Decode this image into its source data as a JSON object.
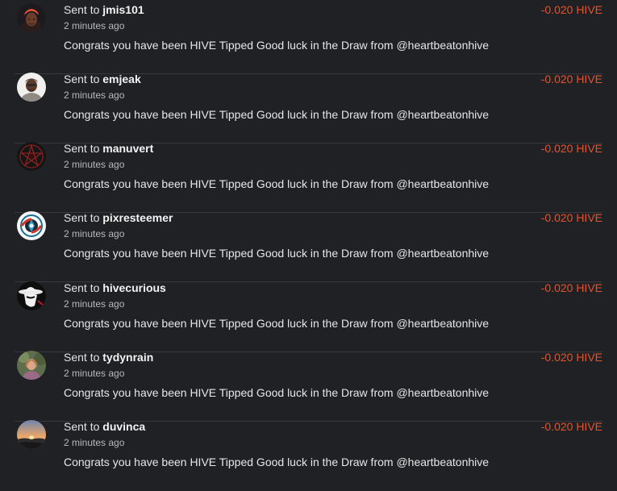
{
  "colors": {
    "background": "#1f2124",
    "amount": "#e2542f",
    "divider": "#35383c"
  },
  "transactions": [
    {
      "prefix": "Sent to",
      "user": "jmis101",
      "time": "2 minutes ago",
      "memo": "Congrats you have been HIVE Tipped Good luck in the Draw from @heartbeatonhive",
      "amount": "-0.020 HIVE",
      "avatar_icon": "woman-orange-headwrap-avatar"
    },
    {
      "prefix": "Sent to",
      "user": "emjeak",
      "time": "2 minutes ago",
      "memo": "Congrats you have been HIVE Tipped Good luck in the Draw from @heartbeatonhive",
      "amount": "-0.020 HIVE",
      "avatar_icon": "man-portrait-avatar"
    },
    {
      "prefix": "Sent to",
      "user": "manuvert",
      "time": "2 minutes ago",
      "memo": "Congrats you have been HIVE Tipped Good luck in the Draw from @heartbeatonhive",
      "amount": "-0.020 HIVE",
      "avatar_icon": "pentagram-avatar"
    },
    {
      "prefix": "Sent to",
      "user": "pixresteemer",
      "time": "2 minutes ago",
      "memo": "Congrats you have been HIVE Tipped Good luck in the Draw from @heartbeatonhive",
      "amount": "-0.020 HIVE",
      "avatar_icon": "camera-aperture-avatar"
    },
    {
      "prefix": "Sent to",
      "user": "hivecurious",
      "time": "2 minutes ago",
      "memo": "Congrats you have been HIVE Tipped Good luck in the Draw from @heartbeatonhive",
      "amount": "-0.020 HIVE",
      "avatar_icon": "hat-silhouette-avatar"
    },
    {
      "prefix": "Sent to",
      "user": "tydynrain",
      "time": "2 minutes ago",
      "memo": "Congrats you have been HIVE Tipped Good luck in the Draw from @heartbeatonhive",
      "amount": "-0.020 HIVE",
      "avatar_icon": "woman-nature-avatar"
    },
    {
      "prefix": "Sent to",
      "user": "duvinca",
      "time": "2 minutes ago",
      "memo": "Congrats you have been HIVE Tipped Good luck in the Draw from @heartbeatonhive",
      "amount": "-0.020 HIVE",
      "avatar_icon": "sunset-landscape-avatar"
    }
  ]
}
